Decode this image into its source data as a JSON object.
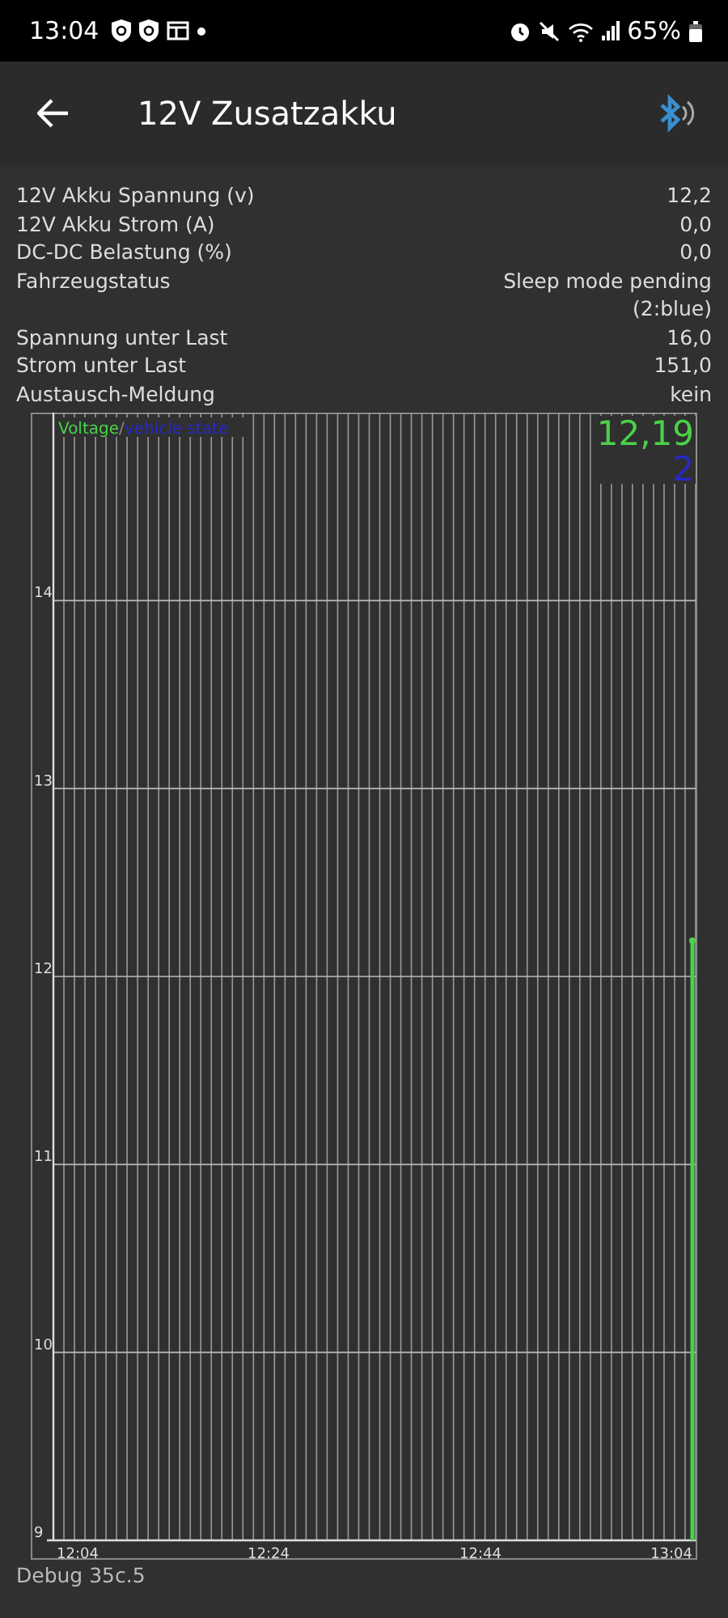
{
  "status_bar": {
    "time": "13:04",
    "battery": "65%"
  },
  "app_bar": {
    "title": "12V Zusatzakku"
  },
  "readings": [
    {
      "label": "12V Akku Spannung (v)",
      "value": "12,2"
    },
    {
      "label": "12V Akku Strom (A)",
      "value": "0,0"
    },
    {
      "label": "DC-DC Belastung (%)",
      "value": "0,0"
    },
    {
      "label": "Fahrzeugstatus",
      "value": "Sleep mode pending (2:blue)"
    },
    {
      "label": "Spannung unter Last",
      "value": "16,0"
    },
    {
      "label": "Strom unter Last",
      "value": "151,0"
    },
    {
      "label": "Austausch-Meldung",
      "value": "kein"
    }
  ],
  "chart": {
    "current_values": [
      {
        "text": "12,19",
        "color": "#4ad24a"
      },
      {
        "text": "2",
        "color": "#2828c8"
      }
    ],
    "legend_separator": "/",
    "chart_data": {
      "type": "line",
      "x": [
        "12:04",
        "12:24",
        "12:44",
        "13:04"
      ],
      "grid": true,
      "ylim": [
        9,
        15
      ],
      "yticks": [
        9,
        10,
        11,
        12,
        13,
        14
      ],
      "series": [
        {
          "name": "Voltage",
          "color": "#4ad24a",
          "marker": true,
          "values": [
            null,
            null,
            null,
            12.19
          ]
        },
        {
          "name": "vehicle state",
          "color": "#2828c8",
          "values": [
            null,
            null,
            null,
            null
          ]
        }
      ]
    }
  },
  "footer": "Debug 35c.5"
}
